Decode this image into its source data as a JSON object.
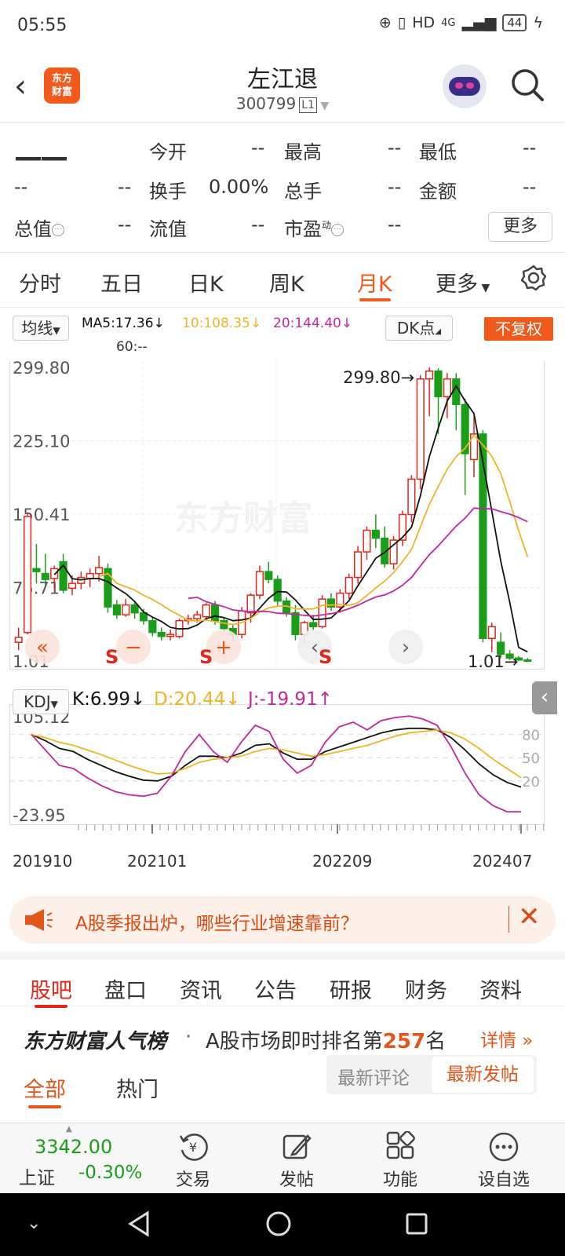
{
  "status": {
    "time": "05:55",
    "network": "HD",
    "signal": "4G",
    "battery": "44"
  },
  "header": {
    "logo": "东方财富",
    "title": "左江退",
    "code": "300799",
    "level": "L1"
  },
  "quote": {
    "price": "——",
    "row1": [
      {
        "label": "今开",
        "value": "--"
      },
      {
        "label": "最高",
        "value": "--"
      },
      {
        "label": "最低",
        "value": "--"
      }
    ],
    "row2": {
      "left_a": "--",
      "left_b": "--",
      "items": [
        {
          "label": "换手",
          "value": "0.00%"
        },
        {
          "label": "总手",
          "value": "--"
        },
        {
          "label": "金额",
          "value": "--"
        }
      ]
    },
    "row3": [
      {
        "label": "总值",
        "value": "--"
      },
      {
        "label": "流值",
        "value": "--"
      },
      {
        "label": "市盈",
        "sup": "动",
        "value": "--"
      }
    ],
    "more": "更多"
  },
  "ktabs": [
    "分时",
    "五日",
    "日K",
    "周K",
    "月K",
    "更多"
  ],
  "ktab_active": 4,
  "indicators": {
    "selector": "均线",
    "ma5": "MA5:17.36↓",
    "ma10": "10:108.35↓",
    "ma20": "20:144.40↓",
    "ma60": "60:--",
    "dk": "DK点",
    "fuquan": "不复权"
  },
  "colors": {
    "up": "#e1261c",
    "down": "#1a9e1a",
    "ma5": "#111111",
    "ma10": "#f0b429",
    "ma20": "#c3279a",
    "accent": "#f25a1c"
  },
  "chart_data": [
    {
      "type": "candlestick",
      "title": "月K",
      "y_ticks": [
        "299.80",
        "225.10",
        "150.41",
        "75.71",
        "1.01"
      ],
      "ylim": [
        1.01,
        299.8
      ],
      "annotations": [
        "299.80",
        "1.01"
      ],
      "markers": [
        "S",
        "S",
        "S"
      ],
      "watermark": "东方财富",
      "candles": [
        {
          "o": 20,
          "h": 35,
          "l": 12,
          "c": 25
        },
        {
          "o": 30,
          "h": 152,
          "l": 28,
          "c": 148
        },
        {
          "o": 95,
          "h": 120,
          "l": 80,
          "c": 92
        },
        {
          "o": 90,
          "h": 110,
          "l": 78,
          "c": 84
        },
        {
          "o": 85,
          "h": 98,
          "l": 74,
          "c": 95
        },
        {
          "o": 102,
          "h": 110,
          "l": 70,
          "c": 73
        },
        {
          "o": 75,
          "h": 88,
          "l": 68,
          "c": 80
        },
        {
          "o": 80,
          "h": 92,
          "l": 74,
          "c": 86
        },
        {
          "o": 85,
          "h": 95,
          "l": 76,
          "c": 90
        },
        {
          "o": 90,
          "h": 108,
          "l": 82,
          "c": 96
        },
        {
          "o": 95,
          "h": 100,
          "l": 50,
          "c": 56
        },
        {
          "o": 58,
          "h": 63,
          "l": 44,
          "c": 48
        },
        {
          "o": 48,
          "h": 64,
          "l": 46,
          "c": 58
        },
        {
          "o": 58,
          "h": 62,
          "l": 44,
          "c": 50
        },
        {
          "o": 50,
          "h": 54,
          "l": 38,
          "c": 42
        },
        {
          "o": 42,
          "h": 46,
          "l": 26,
          "c": 30
        },
        {
          "o": 30,
          "h": 35,
          "l": 22,
          "c": 26
        },
        {
          "o": 26,
          "h": 33,
          "l": 22,
          "c": 28
        },
        {
          "o": 26,
          "h": 44,
          "l": 24,
          "c": 42
        },
        {
          "o": 42,
          "h": 48,
          "l": 38,
          "c": 44
        },
        {
          "o": 44,
          "h": 52,
          "l": 40,
          "c": 48
        },
        {
          "o": 46,
          "h": 60,
          "l": 42,
          "c": 58
        },
        {
          "o": 58,
          "h": 62,
          "l": 38,
          "c": 42
        },
        {
          "o": 42,
          "h": 45,
          "l": 30,
          "c": 34
        },
        {
          "o": 34,
          "h": 38,
          "l": 25,
          "c": 28
        },
        {
          "o": 28,
          "h": 56,
          "l": 24,
          "c": 52
        },
        {
          "o": 50,
          "h": 70,
          "l": 40,
          "c": 68
        },
        {
          "o": 68,
          "h": 98,
          "l": 64,
          "c": 92
        },
        {
          "o": 92,
          "h": 102,
          "l": 80,
          "c": 84
        },
        {
          "o": 84,
          "h": 88,
          "l": 56,
          "c": 62
        },
        {
          "o": 62,
          "h": 66,
          "l": 46,
          "c": 50
        },
        {
          "o": 50,
          "h": 58,
          "l": 22,
          "c": 28
        },
        {
          "o": 28,
          "h": 42,
          "l": 20,
          "c": 40
        },
        {
          "o": 40,
          "h": 48,
          "l": 32,
          "c": 36
        },
        {
          "o": 36,
          "h": 68,
          "l": 34,
          "c": 64
        },
        {
          "o": 64,
          "h": 70,
          "l": 52,
          "c": 56
        },
        {
          "o": 56,
          "h": 74,
          "l": 50,
          "c": 70
        },
        {
          "o": 70,
          "h": 90,
          "l": 64,
          "c": 86
        },
        {
          "o": 86,
          "h": 118,
          "l": 80,
          "c": 112
        },
        {
          "o": 112,
          "h": 138,
          "l": 104,
          "c": 134
        },
        {
          "o": 134,
          "h": 150,
          "l": 116,
          "c": 126
        },
        {
          "o": 126,
          "h": 138,
          "l": 96,
          "c": 100
        },
        {
          "o": 100,
          "h": 128,
          "l": 94,
          "c": 124
        },
        {
          "o": 124,
          "h": 154,
          "l": 118,
          "c": 150
        },
        {
          "o": 150,
          "h": 190,
          "l": 142,
          "c": 186
        },
        {
          "o": 186,
          "h": 292,
          "l": 176,
          "c": 288
        },
        {
          "o": 288,
          "h": 299.8,
          "l": 250,
          "c": 296
        },
        {
          "o": 296,
          "h": 299,
          "l": 232,
          "c": 270
        },
        {
          "o": 270,
          "h": 294,
          "l": 248,
          "c": 288
        },
        {
          "o": 288,
          "h": 294,
          "l": 236,
          "c": 262
        },
        {
          "o": 262,
          "h": 268,
          "l": 170,
          "c": 212
        },
        {
          "o": 206,
          "h": 250,
          "l": 188,
          "c": 232
        },
        {
          "o": 232,
          "h": 236,
          "l": 20,
          "c": 24
        },
        {
          "o": 24,
          "h": 40,
          "l": 10,
          "c": 36
        },
        {
          "o": 20,
          "h": 30,
          "l": 4,
          "c": 8
        },
        {
          "o": 8,
          "h": 12,
          "l": 2,
          "c": 4
        },
        {
          "o": 4,
          "h": 6,
          "l": 1.01,
          "c": 2
        },
        {
          "o": 2,
          "h": 4,
          "l": 1.01,
          "c": 1.5
        }
      ]
    },
    {
      "type": "line",
      "title": "KDJ",
      "y_ticks": [
        "105.12",
        "-23.95"
      ],
      "right_ticks": [
        "80",
        "50",
        "20"
      ],
      "ylim": [
        -23.95,
        105.12
      ],
      "x_ticks": [
        "201910",
        "202101",
        "202209",
        "202407"
      ],
      "series": [
        {
          "name": "K",
          "values": [
            80,
            72,
            62,
            58,
            48,
            40,
            32,
            26,
            21,
            20,
            26,
            40,
            52,
            52,
            50,
            56,
            66,
            68,
            56,
            48,
            48,
            58,
            64,
            70,
            76,
            82,
            86,
            88,
            88,
            86,
            76,
            60,
            42,
            28,
            18,
            12
          ]
        },
        {
          "name": "D",
          "values": [
            80,
            76,
            70,
            66,
            60,
            54,
            47,
            40,
            34,
            29,
            30,
            36,
            44,
            48,
            50,
            52,
            58,
            62,
            60,
            56,
            52,
            54,
            58,
            62,
            66,
            72,
            78,
            82,
            84,
            86,
            82,
            74,
            62,
            48,
            36,
            24
          ]
        },
        {
          "name": "J",
          "values": [
            80,
            60,
            40,
            36,
            24,
            14,
            6,
            2,
            0,
            4,
            26,
            58,
            80,
            58,
            44,
            70,
            92,
            84,
            48,
            30,
            40,
            70,
            90,
            96,
            86,
            98,
            102,
            104,
            100,
            92,
            64,
            30,
            2,
            -12,
            -20,
            -20
          ]
        }
      ]
    }
  ],
  "kdj": {
    "selector": "KDJ",
    "k": "K:6.99↓",
    "d": "D:20.44↓",
    "j": "J:-19.91↑"
  },
  "banner": {
    "text": "A股季报出炉，哪些行业增速靠前？"
  },
  "bottom_tabs": [
    "股吧",
    "盘口",
    "资讯",
    "公告",
    "研报",
    "财务",
    "资料"
  ],
  "rank": {
    "title": "东方财富人气榜",
    "text_a": "A股市场即时排名第",
    "num": "257",
    "text_b": "名",
    "detail": "详情"
  },
  "sub_tabs": {
    "all": "全部",
    "hot": "热门",
    "latest_comment": "最新评论",
    "latest_post": "最新发帖"
  },
  "index": {
    "value": "3342.00",
    "name": "上证",
    "change": "-0.30%"
  },
  "nav": [
    "交易",
    "发帖",
    "功能",
    "设自选"
  ]
}
